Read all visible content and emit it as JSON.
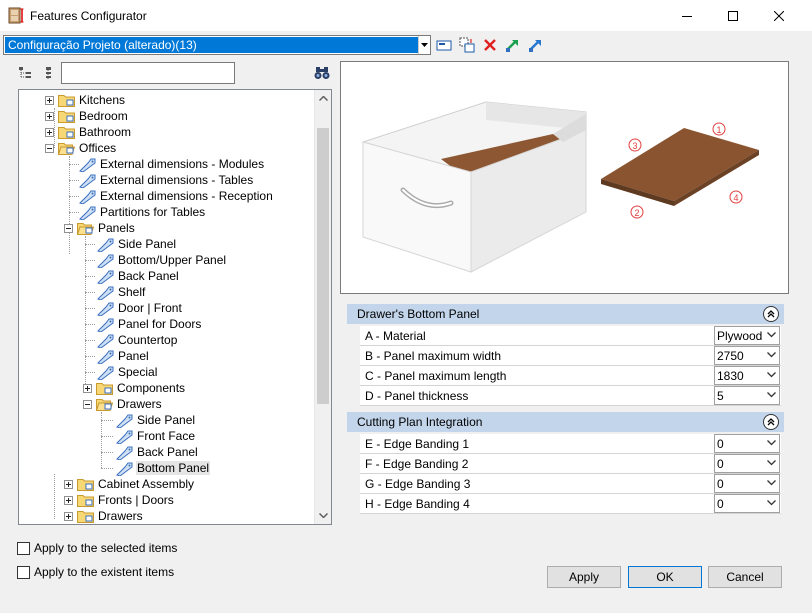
{
  "window": {
    "title": "Features Configurator",
    "controls": {
      "minimize": "minimize-icon",
      "maximize": "maximize-icon",
      "close": "close-icon"
    }
  },
  "config": {
    "selected": "Configuração Projeto (alterado)(13)",
    "toolbar_icons": [
      "save-config-icon",
      "rename-config-icon",
      "delete-icon",
      "import-icon",
      "export-icon"
    ]
  },
  "tree": {
    "search_value": "",
    "nodes": [
      {
        "label": "Kitchens",
        "icon": "folder"
      },
      {
        "label": "Bedroom",
        "icon": "folder"
      },
      {
        "label": "Bathroom",
        "icon": "folder"
      },
      {
        "label": "Offices",
        "icon": "folder"
      },
      {
        "label": "External dimensions - Modules",
        "icon": "tag"
      },
      {
        "label": "External dimensions - Tables",
        "icon": "tag"
      },
      {
        "label": "External dimensions - Reception",
        "icon": "tag"
      },
      {
        "label": "Partitions for Tables",
        "icon": "tag"
      },
      {
        "label": "Panels",
        "icon": "folder"
      },
      {
        "label": "Side Panel",
        "icon": "tag"
      },
      {
        "label": "Bottom/Upper Panel",
        "icon": "tag"
      },
      {
        "label": "Back Panel",
        "icon": "tag"
      },
      {
        "label": "Shelf",
        "icon": "tag"
      },
      {
        "label": "Door | Front",
        "icon": "tag"
      },
      {
        "label": "Panel for Doors",
        "icon": "tag"
      },
      {
        "label": "Countertop",
        "icon": "tag"
      },
      {
        "label": "Panel",
        "icon": "tag"
      },
      {
        "label": "Special",
        "icon": "tag"
      },
      {
        "label": "Components",
        "icon": "folder"
      },
      {
        "label": "Drawers",
        "icon": "folder"
      },
      {
        "label": "Side Panel",
        "icon": "tag"
      },
      {
        "label": "Front Face",
        "icon": "tag"
      },
      {
        "label": "Back Panel",
        "icon": "tag"
      },
      {
        "label": "Bottom Panel",
        "icon": "tag",
        "selected": true
      },
      {
        "label": "Cabinet Assembly",
        "icon": "folder"
      },
      {
        "label": "Fronts | Doors",
        "icon": "folder"
      },
      {
        "label": "Drawers",
        "icon": "folder"
      }
    ]
  },
  "options": {
    "apply_selected": "Apply to the selected items",
    "apply_existent": "Apply to the existent items"
  },
  "preview": {
    "markers": [
      "1",
      "2",
      "3",
      "4"
    ]
  },
  "groups": {
    "bottom_panel": {
      "title": "Drawer's Bottom Panel",
      "rows": [
        {
          "label": "A - Material",
          "value": "Plywood"
        },
        {
          "label": "B - Panel maximum width",
          "value": "2750"
        },
        {
          "label": "C - Panel maximum length",
          "value": "1830"
        },
        {
          "label": "D - Panel thickness",
          "value": "5"
        }
      ]
    },
    "cutting": {
      "title": "Cutting Plan Integration",
      "rows": [
        {
          "label": "E - Edge Banding 1",
          "value": "0"
        },
        {
          "label": "F - Edge Banding 2",
          "value": "0"
        },
        {
          "label": "G - Edge Banding 3",
          "value": "0"
        },
        {
          "label": "H - Edge Banding 4",
          "value": "0"
        }
      ]
    }
  },
  "buttons": {
    "apply": "Apply",
    "ok": "OK",
    "cancel": "Cancel"
  }
}
